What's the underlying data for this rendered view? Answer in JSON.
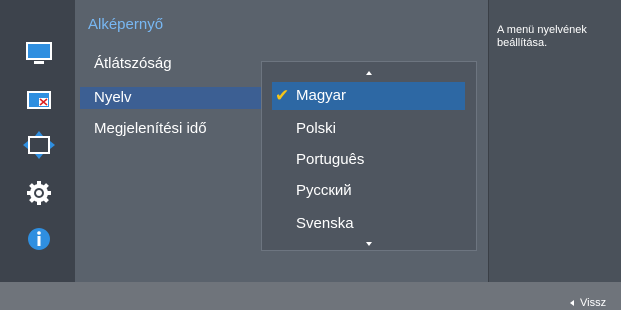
{
  "sidebar": {
    "icons": [
      "monitor-icon",
      "picture-in-picture-icon",
      "resize-arrows-icon",
      "gear-icon",
      "info-icon"
    ]
  },
  "menu": {
    "title": "Alképernyő",
    "items": [
      {
        "label": "Átlátszóság"
      },
      {
        "label": "Nyelv"
      },
      {
        "label": "Megjelenítési idő"
      }
    ]
  },
  "dropdown": {
    "options": [
      "Magyar",
      "Polski",
      "Português",
      "Русский",
      "Svenska"
    ],
    "selected": "Magyar"
  },
  "help": {
    "text": "A menü nyelvének beállítása."
  },
  "footer": {
    "back_label": "Vissz"
  },
  "colors": {
    "title": "#78b8f4",
    "highlight": "#3c5f93",
    "selected_option": "#2d68a4",
    "check": "#f5c518"
  }
}
